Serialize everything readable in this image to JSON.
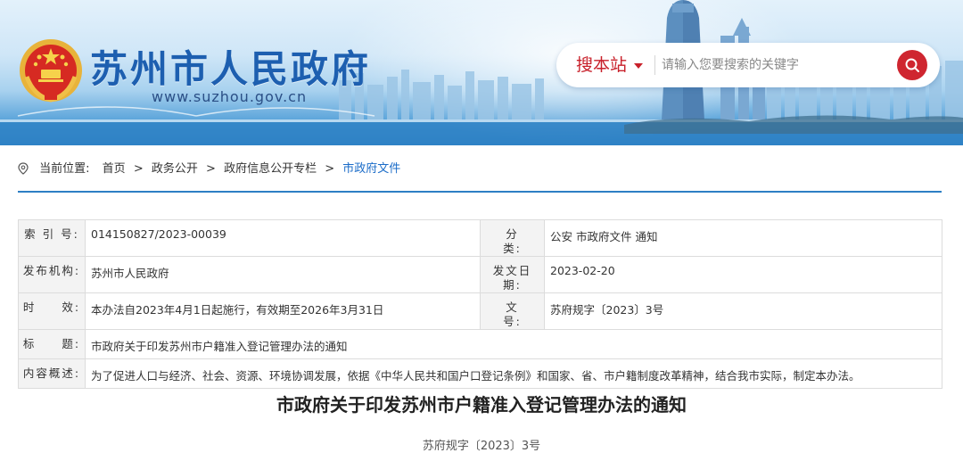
{
  "header": {
    "site_title": "苏州市人民政府",
    "site_url": "www.suzhou.gov.cn",
    "emblem_icon": "national-emblem-icon"
  },
  "search": {
    "scope_label": "搜本站",
    "placeholder": "请输入您要搜索的关键字",
    "accent_color": "#cf2630"
  },
  "breadcrumb": {
    "label": "当前位置:",
    "items": [
      "首页",
      "政务公开",
      "政府信息公开专栏"
    ],
    "current": "市政府文件",
    "separator": ">"
  },
  "meta": {
    "index_label": "索 引 号:",
    "index_value": "014150827/2023-00039",
    "category_label": "分　　类:",
    "category_value": "公安 市政府文件 通知",
    "publisher_label": "发布机构:",
    "publisher_value": "苏州市人民政府",
    "date_label": "发文日期:",
    "date_value": "2023-02-20",
    "validity_label": "时　　效:",
    "validity_value": "本办法自2023年4月1日起施行，有效期至2026年3月31日",
    "docno_label": "文　　号:",
    "docno_value": "苏府规字〔2023〕3号",
    "title_label": "标　　题:",
    "title_value": "市政府关于印发苏州市户籍准入登记管理办法的通知",
    "summary_label": "内容概述:",
    "summary_value": "为了促进人口与经济、社会、资源、环境协调发展，依据《中华人民共和国户口登记条例》和国家、省、市户籍制度改革精神，结合我市实际，制定本办法。"
  },
  "article": {
    "title": "市政府关于印发苏州市户籍准入登记管理办法的通知",
    "doc_number": "苏府规字〔2023〕3号"
  },
  "colors": {
    "brand_blue": "#1d5fb0",
    "link_blue": "#1b6cc8",
    "rule_blue": "#2d7fc4"
  }
}
